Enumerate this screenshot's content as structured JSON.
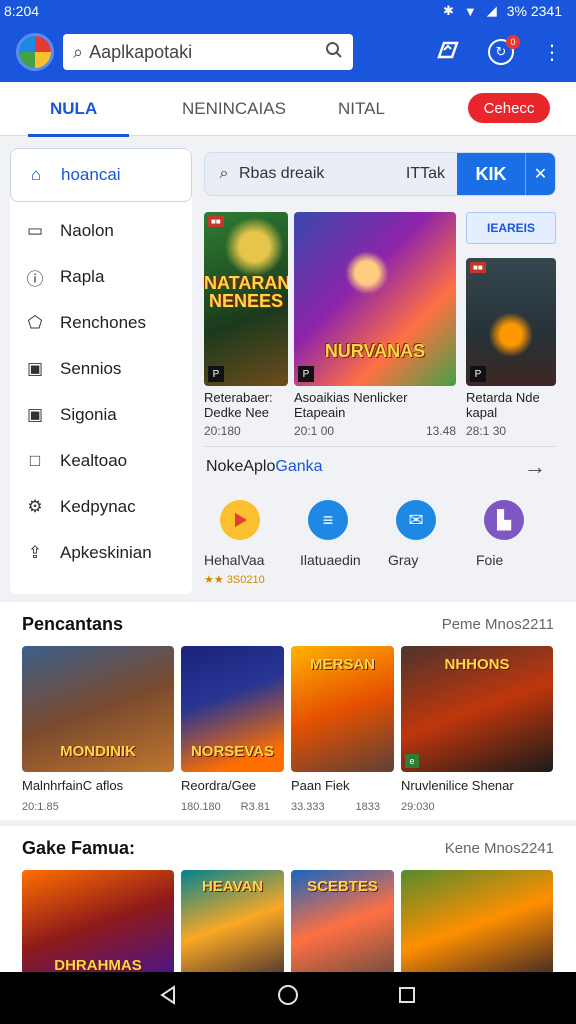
{
  "status_bar": {
    "time": "8:204",
    "right_text": "3% 2341"
  },
  "search": {
    "placeholder": "Aaplkapotaki"
  },
  "tabs": [
    {
      "label": "NULA"
    },
    {
      "label": "NENINCAIAS"
    },
    {
      "label": "NITAL"
    }
  ],
  "red_button": "Cehecc",
  "sidebar": {
    "items": [
      {
        "label": "hoancai",
        "icon": "home-icon"
      },
      {
        "label": "Naolon",
        "icon": "box-icon"
      },
      {
        "label": "Rapla",
        "icon": "info-icon"
      },
      {
        "label": "Renchones",
        "icon": "gift-icon"
      },
      {
        "label": "Sennios",
        "icon": "s-square-icon"
      },
      {
        "label": "Sigonia",
        "icon": "s-square-icon"
      },
      {
        "label": "Kealtoao",
        "icon": "square-icon"
      },
      {
        "label": "Kedpynac",
        "icon": "gear-icon"
      },
      {
        "label": "Apkeskinian",
        "icon": "download-icon"
      }
    ]
  },
  "main_search": {
    "placeholder": "Rbas dreaik",
    "value": "ITTak",
    "button_label": "KIK",
    "close_label": "✕"
  },
  "featured": [
    {
      "title": "Reterabaer: Dedke Nee",
      "meta_left": "20:180",
      "meta_right": "",
      "art_title": "NATARAN NENEES",
      "tag": "P"
    },
    {
      "title": "Asoaikias Nenlicker Etapeain",
      "meta_left": "20:1 00",
      "meta_right": "13.48",
      "art_title": "NURVANAS",
      "tag": "P"
    },
    {
      "title": "Retarda Nde kapal",
      "meta_left": "28:1 30",
      "meta_right": "",
      "chip": "IEAREIS",
      "tag": "P"
    }
  ],
  "catalog": {
    "title_prefix": "NokeAplo",
    "title_highlight": "Ganka"
  },
  "apps": [
    {
      "name": "HehalVaa",
      "rating": "★★ 3S0210",
      "icon": "play-icon",
      "color": "#fbc02d"
    },
    {
      "name": "Ilatuaedin",
      "rating": "",
      "icon": "list-icon",
      "color": "#1e88e5"
    },
    {
      "name": "Gray",
      "rating": "",
      "icon": "mail-icon",
      "color": "#1e88e5"
    },
    {
      "name": "Foie",
      "rating": "",
      "icon": "doc-icon",
      "color": "#7e57c2"
    }
  ],
  "section1": {
    "title": "Pencantans",
    "more": "Peme Mnos2211",
    "cards": [
      {
        "title": "MalnhrfainC aflos",
        "meta_left": "20:1.85",
        "meta_right": "",
        "art_title": "MONDINIK"
      },
      {
        "title": "Reordra/Gee",
        "meta_left": "180.180",
        "meta_right": "R3.81",
        "art_title": "NORSEVAS"
      },
      {
        "title": "Paan Fiek",
        "meta_left": "33.333",
        "meta_right": "1833",
        "art_title": "MERSAN"
      },
      {
        "title": "Nruvlenilice Shenar",
        "meta_left": "29:030",
        "meta_right": "",
        "art_title": "NHHONS"
      }
    ]
  },
  "section2": {
    "title": "Gake Famua:",
    "more": "Kene Mnos2241",
    "cards": [
      {
        "art_title": "DHRAHMAS"
      },
      {
        "art_title": "HEAVAN"
      },
      {
        "art_title": "SCEBTES"
      },
      {
        "art_title": ""
      }
    ]
  }
}
